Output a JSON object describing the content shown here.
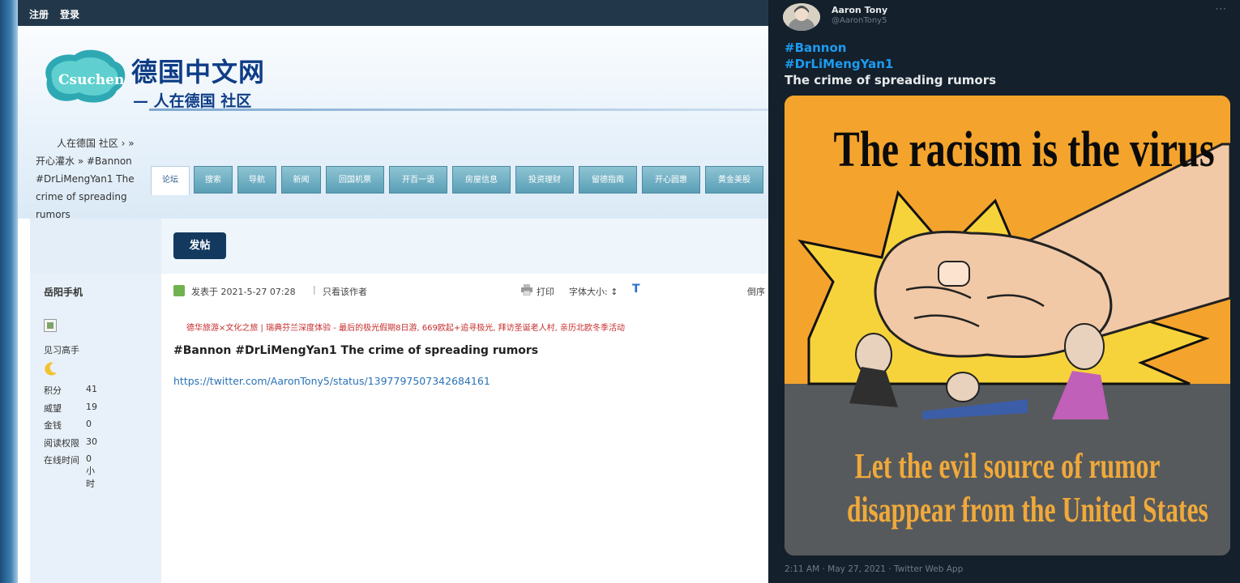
{
  "forum": {
    "topbar": {
      "register": "注册",
      "login": "登录"
    },
    "logo": {
      "badge": "Csuchen",
      "title": "德国中文网",
      "subtitle": "— 人在德国 社区"
    },
    "breadcrumb": {
      "line1": "人在德国 社区 ›  »",
      "line2": "开心灌水 » #Bannon",
      "line3": "#DrLiMengYan1 The",
      "line4": "crime of spreading",
      "line5": "rumors"
    },
    "nav_tabs": [
      "论坛",
      "搜索",
      "导航",
      "新闻",
      "回国机票",
      "开百一语",
      "房屋信息",
      "投资理财",
      "留德指南",
      "开心圆惠",
      "黄金美股"
    ],
    "post_button": "发帖",
    "user": {
      "name": "岳阳手机",
      "group": "见习高手",
      "stats": [
        {
          "label": "积分",
          "value": "41"
        },
        {
          "label": "威望",
          "value": "19"
        },
        {
          "label": "金钱",
          "value": "0"
        },
        {
          "label": "阅读权限",
          "value": "30"
        },
        {
          "label": "在线时间",
          "value": "0 小时"
        }
      ]
    },
    "post": {
      "posted": "发表于 2021-5-27 07:28",
      "sep": "|",
      "only_author": "只看该作者",
      "print": "打印",
      "font_size": "字体大小: ↕",
      "font_t": "T",
      "more": "倒序",
      "ad": "德华旅游×文化之旅 | 瑞典芬兰深度体验 - 最后的极光假期8日游, 669欧起+追寻极光, 拜访圣诞老人村, 亲历北欧冬季活动",
      "title": "#Bannon #DrLiMengYan1 The crime of spreading rumors",
      "link": "https://twitter.com/AaronTony5/status/1397797507342684161"
    }
  },
  "tweet": {
    "name": "Aaron Tony",
    "handle": "@AaronTony5",
    "more": "···",
    "hashtags": [
      "#Bannon",
      "#DrLiMengYan1"
    ],
    "text": "The crime of spreading rumors",
    "image": {
      "title": "The racism is the virus",
      "caption_line1": "Let the evil source of rumor",
      "caption_line2": "disappear from the United States"
    },
    "footer": "2:11 AM · May 27, 2021 · Twitter Web App"
  },
  "colors": {
    "forum_topbar": "#22384a",
    "forum_nav": "#6aa8bd",
    "forum_link": "#2a72b5",
    "forum_ad": "#c62b2b",
    "tweet_bg": "#14202c",
    "tweet_hashtag": "#1d9bf0",
    "image_orange": "#f4a42d",
    "image_gray": "#575a5c"
  },
  "icons": [
    "post-status-icon",
    "print-icon",
    "avatar-image",
    "rank-badge-icon",
    "more-icon"
  ]
}
